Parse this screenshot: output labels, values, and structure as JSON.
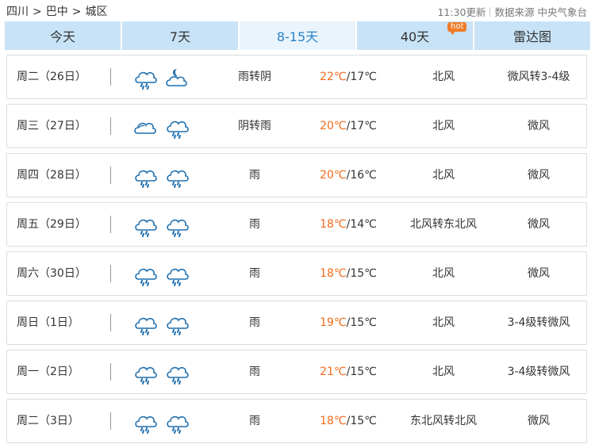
{
  "breadcrumb": {
    "items": [
      "四川",
      "巴中",
      "城区"
    ]
  },
  "source": {
    "updated": "11:30更新",
    "label": "数据来源",
    "provider": "中央气象台"
  },
  "tabs": [
    {
      "label": "今天"
    },
    {
      "label": "7天"
    },
    {
      "label": "8-15天",
      "active": true
    },
    {
      "label": "40天",
      "badge": "hot"
    },
    {
      "label": "雷达图"
    }
  ],
  "forecast": [
    {
      "day": "周二（26日）",
      "icons": [
        "rain-cloud-icon",
        "cloudy-moon-icon"
      ],
      "desc": "雨转阴",
      "high": "22℃",
      "low": "17℃",
      "wind_dir": "北风",
      "wind_level": "微风转3-4级"
    },
    {
      "day": "周三（27日）",
      "icons": [
        "overcast-cloud-icon",
        "rain-cloud-icon"
      ],
      "desc": "阴转雨",
      "high": "20℃",
      "low": "17℃",
      "wind_dir": "北风",
      "wind_level": "微风"
    },
    {
      "day": "周四（28日）",
      "icons": [
        "rain-cloud-icon",
        "rain-cloud-icon"
      ],
      "desc": "雨",
      "high": "20℃",
      "low": "16℃",
      "wind_dir": "北风",
      "wind_level": "微风"
    },
    {
      "day": "周五（29日）",
      "icons": [
        "rain-cloud-icon",
        "rain-cloud-icon"
      ],
      "desc": "雨",
      "high": "18℃",
      "low": "14℃",
      "wind_dir": "北风转东北风",
      "wind_level": "微风"
    },
    {
      "day": "周六（30日）",
      "icons": [
        "rain-cloud-icon",
        "rain-cloud-icon"
      ],
      "desc": "雨",
      "high": "18℃",
      "low": "15℃",
      "wind_dir": "北风",
      "wind_level": "微风"
    },
    {
      "day": "周日（1日）",
      "icons": [
        "rain-cloud-icon",
        "rain-cloud-icon"
      ],
      "desc": "雨",
      "high": "19℃",
      "low": "15℃",
      "wind_dir": "北风",
      "wind_level": "3-4级转微风"
    },
    {
      "day": "周一（2日）",
      "icons": [
        "rain-cloud-icon",
        "rain-cloud-icon"
      ],
      "desc": "雨",
      "high": "21℃",
      "low": "15℃",
      "wind_dir": "北风",
      "wind_level": "3-4级转微风"
    },
    {
      "day": "周二（3日）",
      "icons": [
        "rain-cloud-icon",
        "rain-cloud-icon"
      ],
      "desc": "雨",
      "high": "18℃",
      "low": "15℃",
      "wind_dir": "东北风转北风",
      "wind_level": "微风"
    }
  ],
  "colors": {
    "accent": "#2c82c6",
    "tab_bg": "#c8e3f7",
    "tab_active_bg": "#eaf4fc",
    "high_temp": "#f26a1b",
    "hot_badge": "#f07c2b",
    "icon_stroke": "#1f6fae"
  }
}
